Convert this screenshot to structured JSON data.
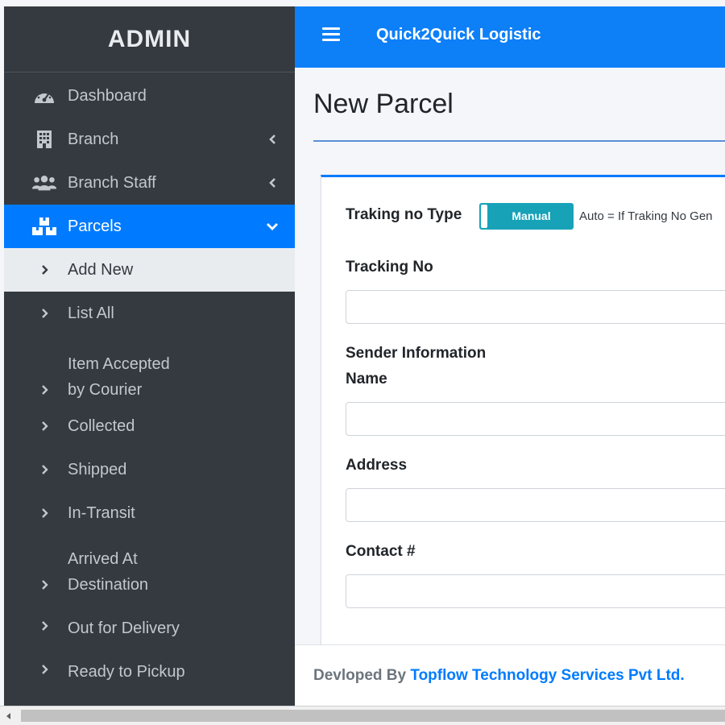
{
  "sidebar": {
    "brand": "ADMIN",
    "items": [
      {
        "label": "Dashboard",
        "icon": "dashboard-gauge-icon"
      },
      {
        "label": "Branch",
        "icon": "building-icon",
        "chevron": "chevron-left-icon"
      },
      {
        "label": "Branch Staff",
        "icon": "users-icon",
        "chevron": "chevron-left-icon"
      },
      {
        "label": "Parcels",
        "icon": "boxes-icon",
        "chevron": "chevron-down-icon",
        "active": true
      }
    ],
    "subitems": [
      {
        "label": "Add New",
        "current": true
      },
      {
        "label": "List All"
      },
      {
        "label": "Item Accepted",
        "label2": "by Courier"
      },
      {
        "label": "Collected"
      },
      {
        "label": "Shipped"
      },
      {
        "label": "In-Transit"
      },
      {
        "label": "Arrived At",
        "label2": "Destination"
      },
      {
        "label": "Out for Delivery"
      },
      {
        "label": "Ready to Pickup"
      }
    ]
  },
  "topbar": {
    "title": "Quick2Quick Logistic",
    "menu_icon": "hamburger-menu-icon"
  },
  "page": {
    "title": "New Parcel"
  },
  "form": {
    "tracking_type_label": "Traking no Type",
    "toggle_label": "Manual",
    "auto_note": "Auto = If Traking No Gen",
    "tracking_no_label": "Tracking No",
    "tracking_no_value": "",
    "sender_section": "Sender Information",
    "name_label": "Name",
    "name_value": "",
    "address_label": "Address",
    "address_value": "",
    "contact_label": "Contact #",
    "contact_value": ""
  },
  "footer": {
    "prefix": "Devloped By",
    "link": "Topflow Technology Services Pvt Ltd."
  },
  "colors": {
    "sidebar_bg": "#343a40",
    "primary": "#007bff",
    "topbar": "#0d7ff7",
    "toggle": "#17a2b8"
  }
}
